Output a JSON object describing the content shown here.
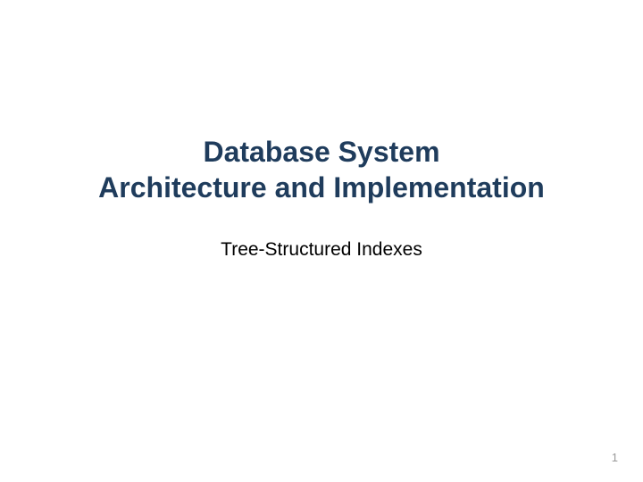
{
  "slide": {
    "title_line1": "Database System",
    "title_line2": "Architecture and Implementation",
    "subtitle": "Tree-Structured Indexes",
    "page_number": "1"
  }
}
